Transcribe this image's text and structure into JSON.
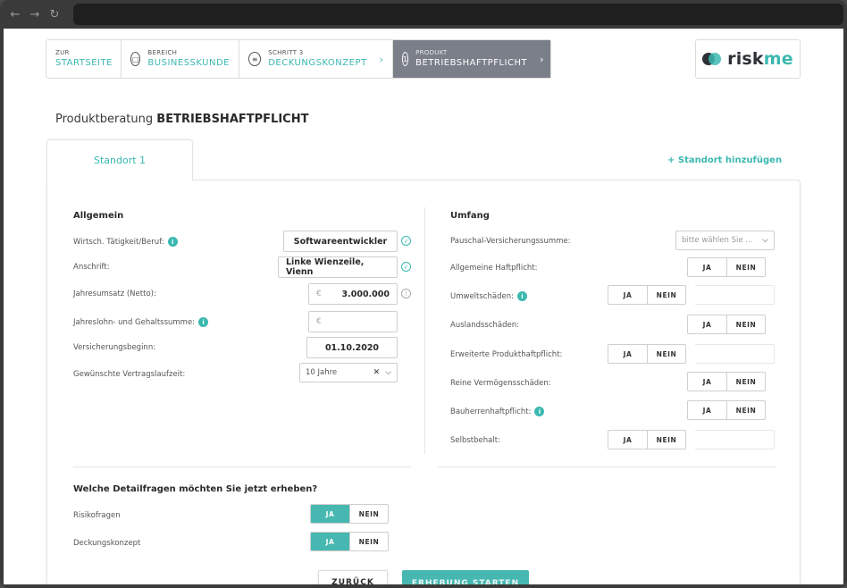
{
  "browser": {
    "back_icon": "←",
    "forward_icon": "→",
    "reload_icon": "↻"
  },
  "breadcrumb": [
    {
      "small": "ZUR",
      "big": "STARTSEITE"
    },
    {
      "small": "BEREICH",
      "big": "BUSINESSKUNDE"
    },
    {
      "small": "SCHRITT 3",
      "big": "DECKUNGSKONZEPT"
    },
    {
      "small": "PRODUKT",
      "big": "BETRIEBSHAFTPFLICHT",
      "step": "1"
    }
  ],
  "logo": {
    "text_a": "risk",
    "text_b": "me"
  },
  "page_title": {
    "prefix": "Produktberatung",
    "product": "BETRIEBSHAFTPFLICHT"
  },
  "tabs": {
    "site1": "Standort 1",
    "add": "+ Standort hinzufügen"
  },
  "allgemein": {
    "heading": "Allgemein",
    "taetigkeit": {
      "label": "Wirtsch. Tätigkeit/Beruf:",
      "value": "Softwareentwickler"
    },
    "anschrift": {
      "label": "Anschrift:",
      "value": "Linke Wienzeile, Vienn"
    },
    "umsatz": {
      "label": "Jahresumsatz (Netto):",
      "currency": "€",
      "value": "3.000.000"
    },
    "gehalt": {
      "label": "Jahreslohn- und Gehaltssumme:",
      "currency": "€",
      "value": ""
    },
    "beginn": {
      "label": "Versicherungsbeginn:",
      "value": "01.10.2020"
    },
    "laufzeit": {
      "label": "Gewünschte Vertragslaufzeit:",
      "value": "10 Jahre"
    }
  },
  "umfang": {
    "heading": "Umfang",
    "pauschal": {
      "label": "Pauschal-Versicherungssumme:",
      "placeholder": "bitte wählen Sie ..."
    },
    "rows": [
      {
        "label": "Allgemeine Haftpflicht:"
      },
      {
        "label": "Umweltschäden:"
      },
      {
        "label": "Auslandsschäden:"
      },
      {
        "label": "Erweiterte Produkthaftpflicht:"
      },
      {
        "label": "Reine Vermögensschäden:"
      },
      {
        "label": "Bauherrenhaftpflicht:"
      },
      {
        "label": "Selbstbehalt:"
      }
    ]
  },
  "yn": {
    "yes": "JA",
    "no": "NEIN"
  },
  "detail": {
    "heading": "Welche Detailfragen möchten Sie jetzt erheben?",
    "risiko": "Risikofragen",
    "deckung": "Deckungskonzept"
  },
  "buttons": {
    "back": "ZURÜCK",
    "start": "ERHEBUNG STARTEN"
  },
  "colors": {
    "accent": "#3bb8b0",
    "active_crumb": "#7b7f8a",
    "dark": "#2e3038"
  }
}
